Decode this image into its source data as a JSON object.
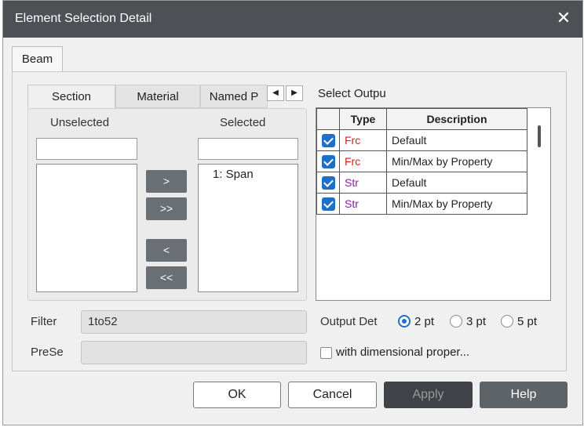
{
  "window": {
    "title": "Element Selection Detail",
    "close_glyph": "✕"
  },
  "main_tab": {
    "label": "Beam"
  },
  "subtabs": [
    {
      "label": "Section",
      "active": true
    },
    {
      "label": "Material",
      "active": false
    },
    {
      "label": "Named P",
      "active": false
    }
  ],
  "subtab_arrows": {
    "left": "◀",
    "right": "▶"
  },
  "section_panel": {
    "unselected_label": "Unselected",
    "selected_label": "Selected",
    "unselected_filter": "",
    "selected_filter": "",
    "unselected_items": [],
    "selected_items": [
      "1: Span"
    ],
    "buttons": {
      "add": ">",
      "add_all": ">>",
      "remove": "<",
      "remove_all": "<<"
    }
  },
  "output": {
    "label": "Select Outpu",
    "columns": [
      "Type",
      "Description"
    ],
    "rows": [
      {
        "checked": true,
        "type": "Frc",
        "description": "Default"
      },
      {
        "checked": true,
        "type": "Frc",
        "description": "Min/Max by Property"
      },
      {
        "checked": true,
        "type": "Str",
        "description": "Default"
      },
      {
        "checked": true,
        "type": "Str",
        "description": "Min/Max by Property"
      }
    ]
  },
  "filter": {
    "label": "Filter",
    "value": "1to52"
  },
  "preset": {
    "label": "PreSe",
    "value": ""
  },
  "output_detail": {
    "label": "Output Det",
    "options": [
      "2 pt",
      "3 pt",
      "5 pt"
    ],
    "selected": "2 pt"
  },
  "dimensional": {
    "label": "with dimensional proper...",
    "checked": false
  },
  "footer": {
    "ok": "OK",
    "cancel": "Cancel",
    "apply": "Apply",
    "help": "Help"
  },
  "colors": {
    "titlebar": "#4d5156",
    "accent": "#1f6fc6",
    "frc": "#d81e1e",
    "str": "#8b1fa0"
  }
}
